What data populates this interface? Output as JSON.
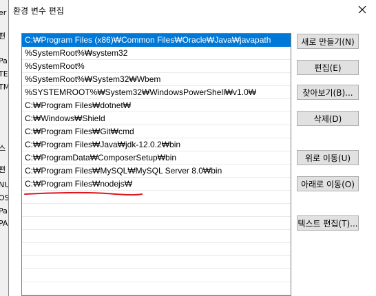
{
  "background_window": {
    "fragments": [
      "er",
      "편",
      "Pa",
      "TE",
      "TM",
      "스",
      "편",
      "NU",
      "OS",
      "Pa",
      "PA"
    ]
  },
  "dialog": {
    "title": "환경 변수 편집"
  },
  "paths": [
    "C:₩Program Files (x86)₩Common Files₩Oracle₩Java₩javapath",
    "%SystemRoot%₩system32",
    "%SystemRoot%",
    "%SystemRoot%₩System32₩Wbem",
    "%SYSTEMROOT%₩System32₩WindowsPowerShell₩v1.0₩",
    "C:₩Program Files₩dotnet₩",
    "C:₩Windows₩Shield",
    "C:₩Program Files₩Git₩cmd",
    "C:₩Program Files₩Java₩jdk-12.0.2₩bin",
    "C:₩ProgramData₩ComposerSetup₩bin",
    "C:₩Program Files₩MySQL₩MySQL Server 8.0₩bin",
    "C:₩Program Files₩nodejs₩"
  ],
  "buttons": {
    "new": "새로 만들기(N)",
    "edit": "편집(E)",
    "browse": "찾아보기(B)...",
    "delete": "삭제(D)",
    "move_up": "위로 이동(U)",
    "move_down": "아래로 이동(O)",
    "edit_text": "텍스트 편집(T)..."
  },
  "colors": {
    "selection": "#0078d7",
    "annotation": "#e0141e"
  }
}
